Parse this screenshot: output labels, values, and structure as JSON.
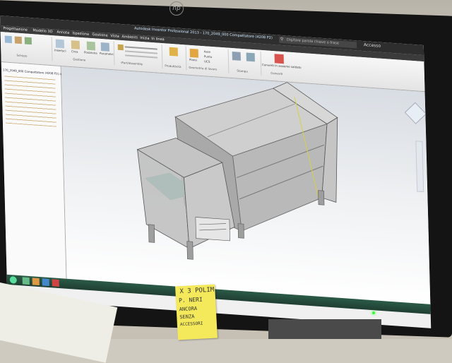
{
  "monitor": {
    "brand_logo": "hp"
  },
  "app": {
    "title": "Autodesk Inventor Professional 2013 - 170_2049_000 Compattatore (4208 P2)",
    "search_placeholder": "Digitare parola chiave o frase",
    "account_label": "Accesso"
  },
  "ribbon": {
    "tabs": [
      "Progettazione",
      "Modello 3D",
      "Annota",
      "Ispeziona",
      "Gestione",
      "Vista",
      "Ambienti",
      "Inizia",
      "In linea"
    ],
    "active_tab": 1,
    "panels": [
      "Schizzo",
      "Gestione",
      "iPart/iAssembly",
      "Produttività",
      "Geometria di lavoro",
      "Stampa",
      "Converti"
    ],
    "panel_tools": {
      "components": [
        "Inserisci",
        "Crea",
        "Posiziona",
        "Parametri"
      ],
      "work_geometry": [
        "Piano",
        "Asse",
        "Punto",
        "UCS"
      ],
      "convert": [
        "Converti in assieme saldato"
      ]
    }
  },
  "browser": {
    "root": "170_2049_000 Compattatore (4208 P2).iam"
  },
  "sticky_note": {
    "lines": [
      "X 3 POLIM",
      "P. NERI",
      "ANCORA",
      "SENZA",
      "ACCESSORI"
    ]
  },
  "colors": {
    "viewport_top": "#d8dde3",
    "viewport_bottom": "#ffffff",
    "title_bar": "#2e2e2e",
    "accent": "#1e6fb8",
    "model": "#bcbcbc",
    "sticky": "#f4e95a"
  },
  "icons": [
    "hp-logo-icon",
    "search-icon",
    "view-cube-icon",
    "nav-bar-icon",
    "power-led-icon"
  ]
}
